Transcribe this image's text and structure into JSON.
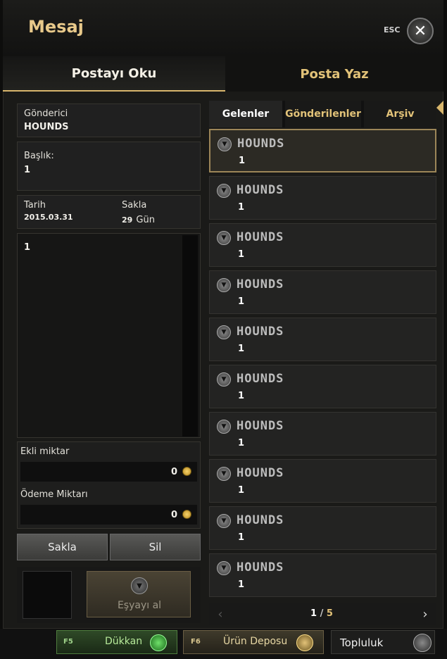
{
  "window": {
    "title": "Mesaj",
    "esc_label": "ESC",
    "close_glyph": "✕"
  },
  "tabs": {
    "read": "Postayı Oku",
    "write": "Posta Yaz"
  },
  "detail": {
    "sender_label": "Gönderici",
    "sender_value": "HOUNDS",
    "subject_label": "Başlık:",
    "subject_value": "1",
    "date_label": "Tarih",
    "date_value": "2015.03.31",
    "keep_label": "Sakla",
    "keep_days": "29",
    "keep_unit": "Gün",
    "body": "1",
    "attached_label": "Ekli miktar",
    "attached_value": "0",
    "payment_label": "Ödeme Miktarı",
    "payment_value": "0",
    "save_button": "Sakla",
    "delete_button": "Sil",
    "take_item_button": "Eşyayı al"
  },
  "list": {
    "subtabs": [
      "Gelenler",
      "Gönderilenler",
      "Arşiv"
    ],
    "items": [
      {
        "sender": "HOUNDS",
        "subject": "1"
      },
      {
        "sender": "HOUNDS",
        "subject": "1"
      },
      {
        "sender": "HOUNDS",
        "subject": "1"
      },
      {
        "sender": "HOUNDS",
        "subject": "1"
      },
      {
        "sender": "HOUNDS",
        "subject": "1"
      },
      {
        "sender": "HOUNDS",
        "subject": "1"
      },
      {
        "sender": "HOUNDS",
        "subject": "1"
      },
      {
        "sender": "HOUNDS",
        "subject": "1"
      },
      {
        "sender": "HOUNDS",
        "subject": "1"
      },
      {
        "sender": "HOUNDS",
        "subject": "1"
      }
    ],
    "pagination": {
      "current": "1",
      "separator": "/",
      "total": "5"
    }
  },
  "bottom_bar": {
    "shop_key": "F5",
    "shop_label": "Dükkan",
    "storage_key": "F6",
    "storage_label": "Ürün Deposu",
    "community_label": "Topluluk"
  }
}
